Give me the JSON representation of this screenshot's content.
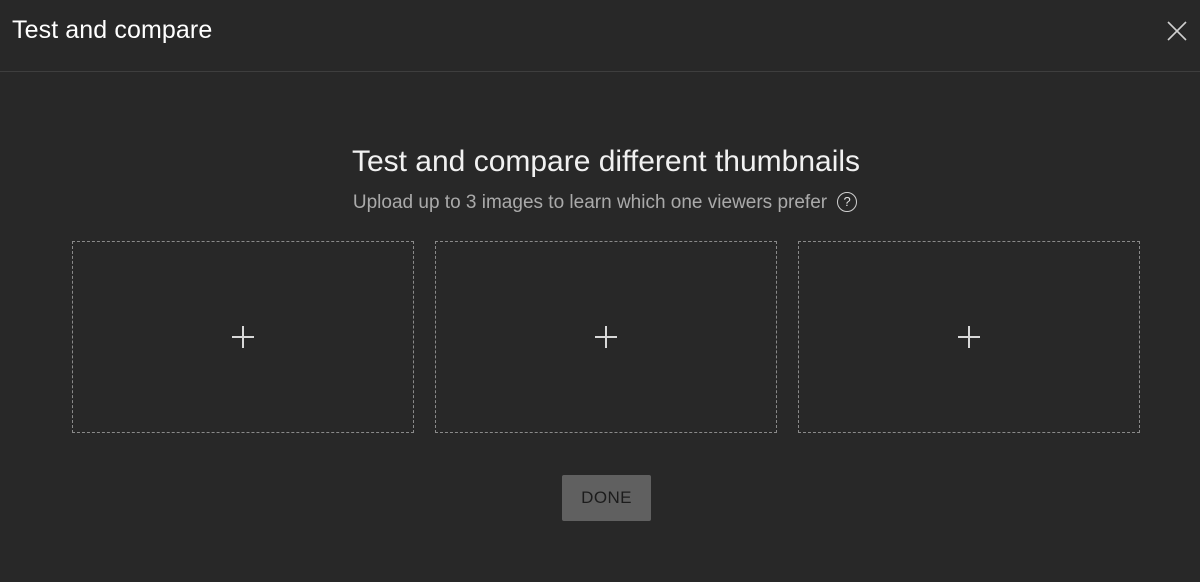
{
  "header": {
    "title": "Test and compare",
    "close_icon": "close-icon"
  },
  "main": {
    "title": "Test and compare different thumbnails",
    "subtitle": "Upload up to 3 images to learn which one viewers prefer",
    "help_glyph": "?",
    "help_icon": "help-circle-icon"
  },
  "slots": [
    {
      "icon": "plus-icon"
    },
    {
      "icon": "plus-icon"
    },
    {
      "icon": "plus-icon"
    }
  ],
  "footer": {
    "done_label": "DONE"
  },
  "colors": {
    "background": "#282828",
    "divider": "#3e3e3e",
    "dashed_border": "#8a8a8a",
    "done_button_bg": "#606060",
    "subtitle_text": "#aaaaaa"
  }
}
